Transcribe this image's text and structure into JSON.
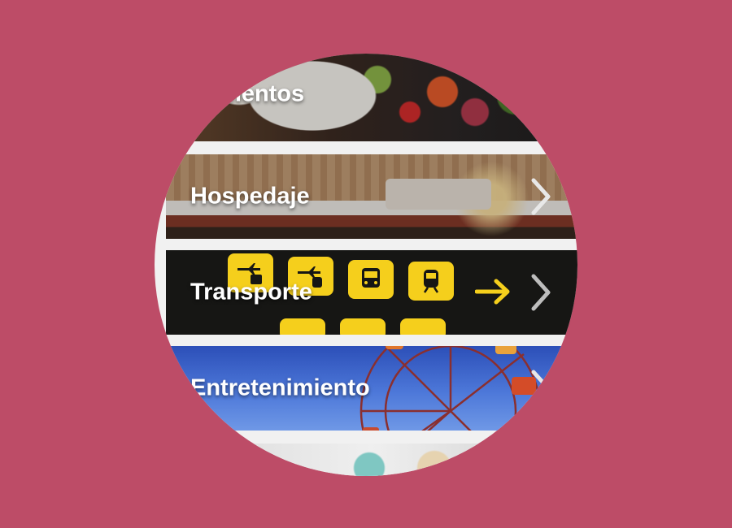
{
  "colors": {
    "background": "#bd4c67",
    "card_gap": "#f1f1f1",
    "label_text": "#ffffff",
    "sign_yellow": "#f5cf1c"
  },
  "categories": [
    {
      "label": "Alimentos",
      "icon": "chevron-right-icon"
    },
    {
      "label": "Hospedaje",
      "icon": "chevron-right-icon"
    },
    {
      "label": "Transporte",
      "icon": "chevron-right-icon"
    },
    {
      "label": "Entretenimiento",
      "icon": "chevron-right-icon"
    }
  ]
}
